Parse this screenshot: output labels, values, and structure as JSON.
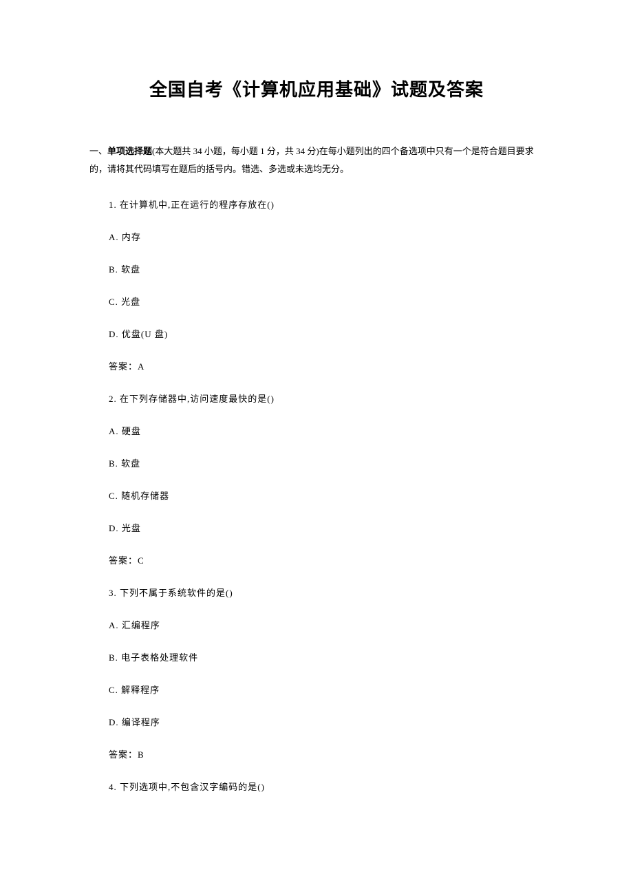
{
  "title": "全国自考《计算机应用基础》试题及答案",
  "section": {
    "prefix": "一、",
    "name": "单项选择题",
    "desc": "(本大题共 34 小题，每小题 1 分，共 34 分)在每小题列出的四个备选项中只有一个是符合题目要求的，请将其代码填写在题后的括号内。错选、多选或未选均无分。"
  },
  "q1": {
    "stem": "1. 在计算机中,正在运行的程序存放在()",
    "A": "A. 内存",
    "B": "B. 软盘",
    "C": "C. 光盘",
    "D": "D. 优盘(U 盘)",
    "answer": "答案：A"
  },
  "q2": {
    "stem": "2. 在下列存储器中,访问速度最快的是()",
    "A": "A. 硬盘",
    "B": "B. 软盘",
    "C": "C. 随机存储器",
    "D": "D. 光盘",
    "answer": "答案：C"
  },
  "q3": {
    "stem": "3. 下列不属于系统软件的是()",
    "A": "A. 汇编程序",
    "B": "B. 电子表格处理软件",
    "C": "C. 解释程序",
    "D": "D. 编译程序",
    "answer": "答案：B"
  },
  "q4": {
    "stem": "4. 下列选项中,不包含汉字编码的是()"
  }
}
